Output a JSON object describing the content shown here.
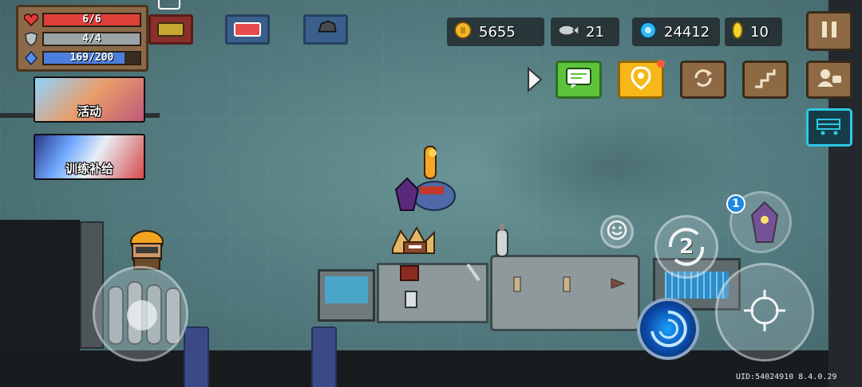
{
  "hud": {
    "hp": {
      "text": "6/6",
      "fraction": 1.0,
      "color": "#e0403a"
    },
    "armor": {
      "text": "4/4",
      "fraction": 1.0,
      "color": "#9aa3a6"
    },
    "energy": {
      "text": "169/200",
      "fraction": 0.845,
      "color": "#4a7fe0"
    }
  },
  "currency": {
    "gold": "5655",
    "fish": "21",
    "gems": "24412",
    "tokens": "10"
  },
  "banners": {
    "event_label": "活动",
    "training_label": "训练补给"
  },
  "controls": {
    "weapon_switch_number": "2",
    "pet_count": "1"
  },
  "footer": {
    "uid": "UID:54024910 8.4.0.29"
  },
  "icons": {
    "heart": "heart-icon",
    "shield": "shield-icon",
    "diamond": "energy-icon",
    "gold": "gold-coin-icon",
    "fish": "fish-icon",
    "gem": "gem-icon",
    "token": "token-icon"
  }
}
